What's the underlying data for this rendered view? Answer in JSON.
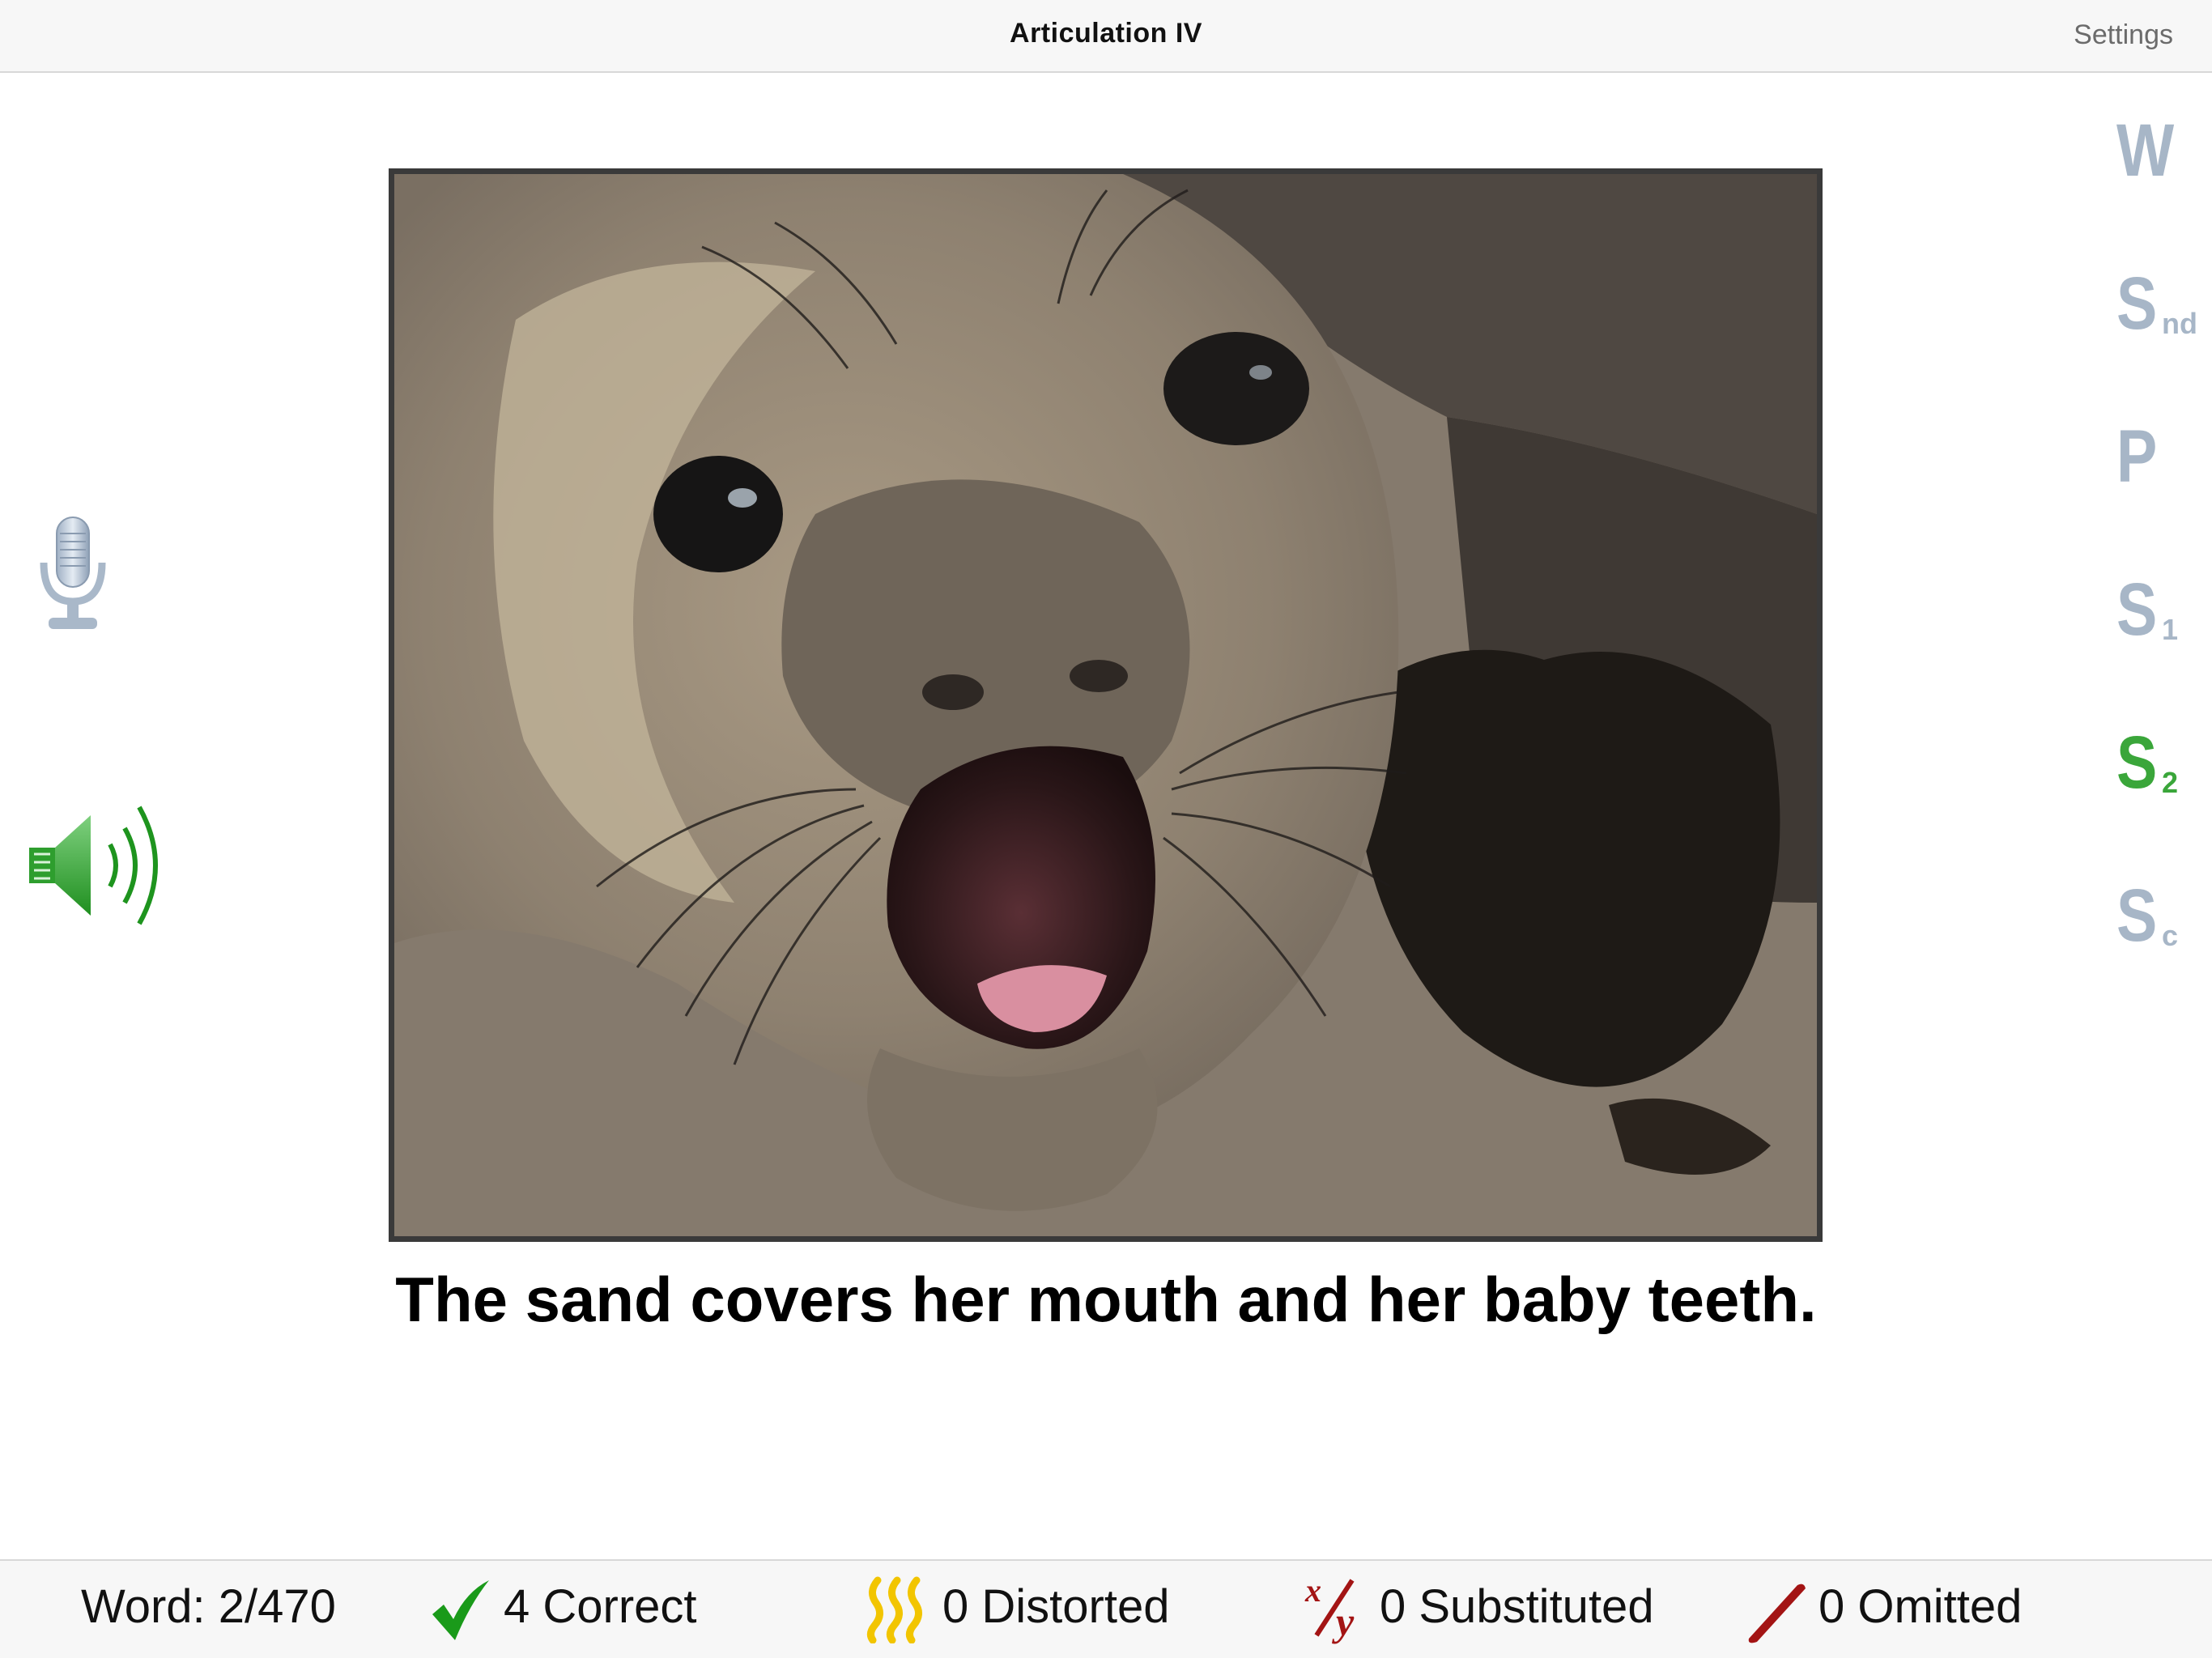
{
  "app": {
    "title": "Articulation IV"
  },
  "nav": {
    "settings_label": "Settings"
  },
  "tools": {
    "mic_icon": "microphone-icon",
    "speaker_icon": "speaker-icon"
  },
  "sentence": {
    "text": "The sand covers her mouth and her baby teeth."
  },
  "positions": [
    {
      "letter": "W",
      "sub": "",
      "active": false
    },
    {
      "letter": "S",
      "sub": "nd",
      "active": false
    },
    {
      "letter": "P",
      "sub": "",
      "active": false
    },
    {
      "letter": "S",
      "sub": "1",
      "active": false
    },
    {
      "letter": "S",
      "sub": "2",
      "active": true
    },
    {
      "letter": "S",
      "sub": "c",
      "active": false
    }
  ],
  "status": {
    "word_label": "Word: 2/470",
    "correct_label": "4 Correct",
    "distorted_label": "0 Distorted",
    "substituted_label": "0 Substituted",
    "omitted_label": "0 Omitted"
  },
  "colors": {
    "active": "#3aa63a",
    "inactive": "#a7b6c7",
    "correct": "#1a9a1a",
    "distorted": "#f2c500",
    "error": "#a31414"
  }
}
